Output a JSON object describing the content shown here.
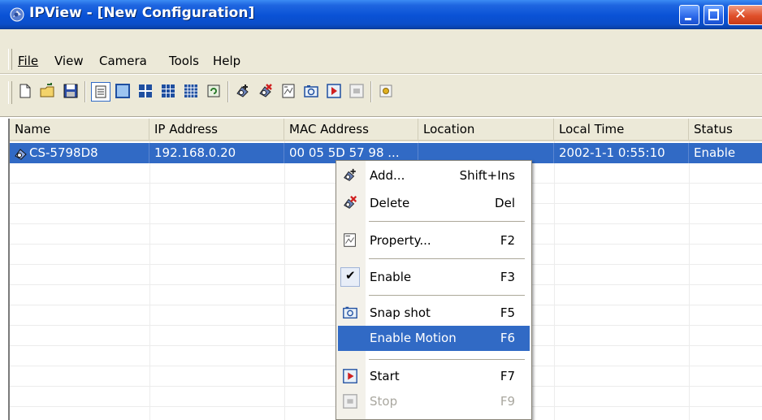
{
  "window": {
    "title": "IPView - [New Configuration]"
  },
  "menubar": {
    "items": [
      {
        "label": "File"
      },
      {
        "label": "View"
      },
      {
        "label": "Camera"
      },
      {
        "label": "Tools"
      },
      {
        "label": "Help"
      }
    ]
  },
  "toolbar": {
    "icons": [
      "new-file-icon",
      "open-folder-icon",
      "save-disk-icon",
      "details-view-icon",
      "single-view-icon",
      "quad-view-icon",
      "nine-view-icon",
      "sixteen-view-icon",
      "refresh-icon",
      "add-camera-icon",
      "delete-camera-icon",
      "property-icon",
      "snapshot-icon",
      "start-icon",
      "stop-icon",
      "settings-icon"
    ]
  },
  "list": {
    "columns": [
      "Name",
      "IP Address",
      "MAC Address",
      "Location",
      "Local Time",
      "Status"
    ],
    "rows": [
      {
        "name": "CS-5798D8",
        "ip": "192.168.0.20",
        "mac": "00 05 5D 57 98 ...",
        "location": "",
        "local_time": "2002-1-1  0:55:10",
        "status": "Enable",
        "selected": true
      }
    ]
  },
  "context_menu": {
    "items": [
      {
        "label": "Add...",
        "shortcut": "Shift+Ins",
        "icon": "add-camera-icon"
      },
      {
        "label": "Delete",
        "shortcut": "Del",
        "icon": "delete-camera-icon"
      },
      {
        "label": "Property...",
        "shortcut": "F2",
        "icon": "property-icon"
      },
      {
        "label": "Enable",
        "shortcut": "F3",
        "icon": "check-icon",
        "checked": true
      },
      {
        "label": "Snap shot",
        "shortcut": "F5",
        "icon": "snapshot-icon"
      },
      {
        "label": "Enable Motion",
        "shortcut": "F6",
        "highlighted": true
      },
      {
        "label": "Start",
        "shortcut": "F7",
        "icon": "start-icon"
      },
      {
        "label": "Stop",
        "shortcut": "F9",
        "icon": "stop-icon",
        "disabled": true
      }
    ]
  },
  "colors": {
    "titlebar": "#0a52d6",
    "selection": "#316ac5",
    "chrome": "#ece9d8"
  }
}
